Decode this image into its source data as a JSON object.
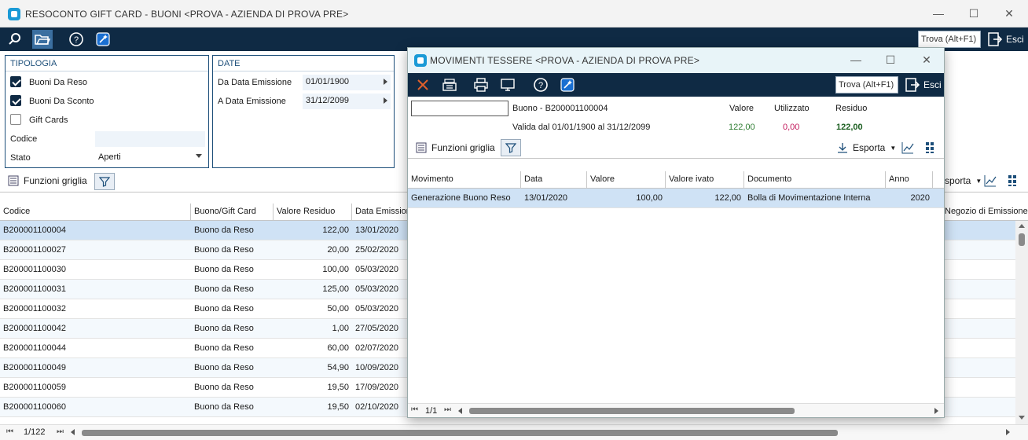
{
  "main_window": {
    "title": "RESOCONTO GIFT CARD - BUONI <PROVA - AZIENDA DI PROVA PRE>",
    "controls": {
      "minimize": "—",
      "maximize": "☐",
      "close": "✕"
    },
    "toolbar": {
      "search_placeholder": "Trova (Alt+F1)",
      "exit_label": "Esci"
    }
  },
  "tipologia": {
    "title": "TIPOLOGIA",
    "options": [
      {
        "label": "Buoni Da Reso",
        "checked": true
      },
      {
        "label": "Buoni Da Sconto",
        "checked": true
      },
      {
        "label": "Gift Cards",
        "checked": false
      }
    ],
    "codice_label": "Codice",
    "codice_value": "",
    "stato_label": "Stato",
    "stato_value": "Aperti"
  },
  "date": {
    "title": "DATE",
    "da_label": "Da Data Emissione",
    "da_value": "01/01/1900",
    "a_label": "A Data Emissione",
    "a_value": "31/12/2099"
  },
  "grid_functions": {
    "label": "Funzioni griglia",
    "export_partial": "sporta",
    "pagination": "1/122"
  },
  "main_grid": {
    "columns": [
      "Codice",
      "Buono/Gift Card",
      "Valore Residuo",
      "Data Emission",
      "Negozio di Emissione"
    ],
    "rows": [
      [
        "B200001100004",
        "Buono da Reso",
        "122,00",
        "13/01/2020"
      ],
      [
        "B200001100027",
        "Buono da Reso",
        "20,00",
        "25/02/2020"
      ],
      [
        "B200001100030",
        "Buono da Reso",
        "100,00",
        "05/03/2020"
      ],
      [
        "B200001100031",
        "Buono da Reso",
        "125,00",
        "05/03/2020"
      ],
      [
        "B200001100032",
        "Buono da Reso",
        "50,00",
        "05/03/2020"
      ],
      [
        "B200001100042",
        "Buono da Reso",
        "1,00",
        "27/05/2020"
      ],
      [
        "B200001100044",
        "Buono da Reso",
        "60,00",
        "02/07/2020"
      ],
      [
        "B200001100049",
        "Buono da Reso",
        "54,90",
        "10/09/2020"
      ],
      [
        "B200001100059",
        "Buono da Reso",
        "19,50",
        "17/09/2020"
      ],
      [
        "B200001100060",
        "Buono da Reso",
        "19,50",
        "02/10/2020"
      ]
    ]
  },
  "dialog": {
    "title": "MOVIMENTI TESSERE <PROVA - AZIENDA DI PROVA PRE>",
    "controls": {
      "minimize": "—",
      "maximize": "☐",
      "close": "✕"
    },
    "toolbar": {
      "search_placeholder": "Trova (Alt+F1)",
      "exit_label": "Esci"
    },
    "info": {
      "input_value": "",
      "buono": "Buono - B200001100004",
      "validity": "Valida dal 01/01/1900 al 31/12/2099",
      "valore_label": "Valore",
      "valore_value": "122,00",
      "utilizzato_label": "Utilizzato",
      "utilizzato_value": "0,00",
      "residuo_label": "Residuo",
      "residuo_value": "122,00"
    },
    "grid_functions_label": "Funzioni griglia",
    "export_label": "Esporta",
    "columns": [
      "Movimento",
      "Data",
      "Valore",
      "Valore ivato",
      "Documento",
      "Anno"
    ],
    "rows": [
      [
        "Generazione Buono Reso",
        "13/01/2020",
        "100,00",
        "122,00",
        "Bolla di Movimentazione Interna",
        "2020"
      ]
    ],
    "pagination": "1/1"
  },
  "colors": {
    "toolbar_bg": "#0f2a44",
    "selected_row": "#cfe2f5",
    "valore_green": "#2e7d32",
    "utilizzato_red": "#c2185b",
    "residuo_green": "#1b5e20"
  }
}
